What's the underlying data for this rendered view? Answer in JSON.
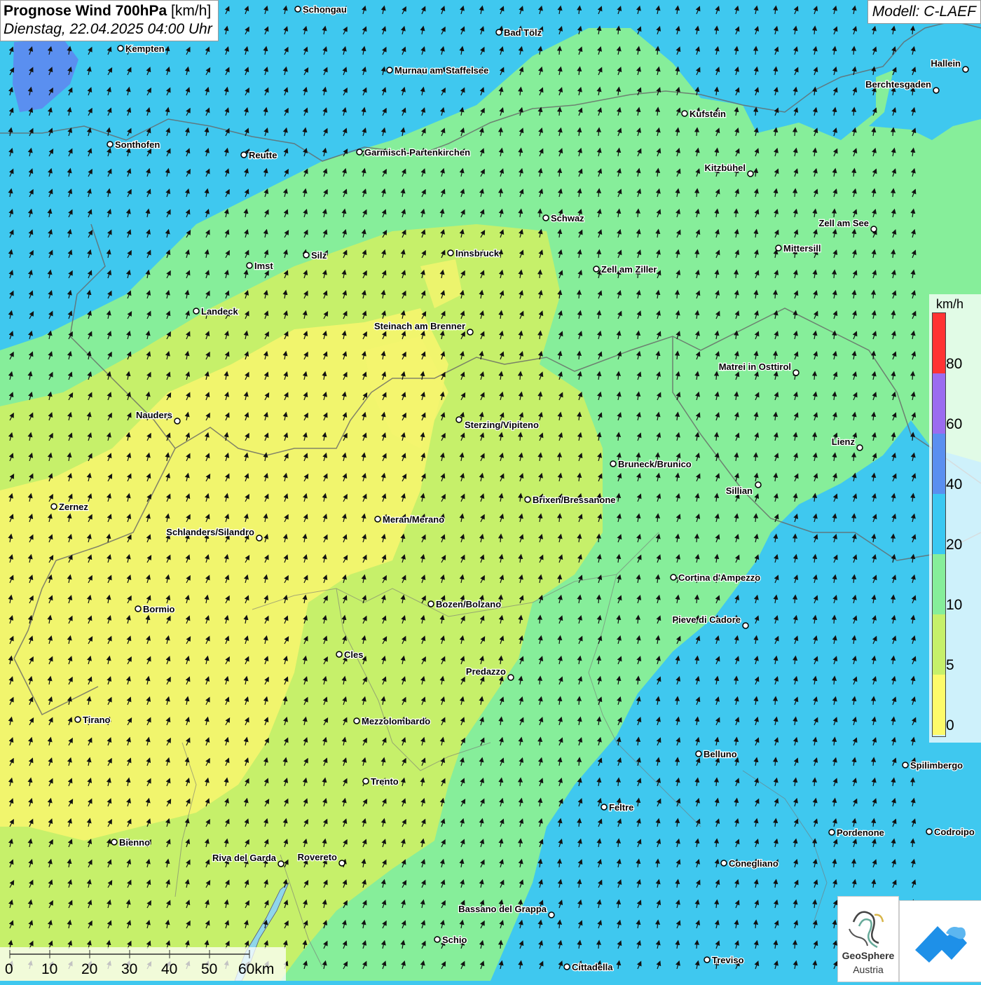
{
  "header": {
    "title_bold": "Prognose Wind 700hPa",
    "title_unit": " [km/h]",
    "datetime": "Dienstag, 22.04.2025 04:00 Uhr"
  },
  "model": "Modell: C-LAEF",
  "legend": {
    "unit": "km/h",
    "labels": [
      "80",
      "60",
      "40",
      "20",
      "10",
      "5",
      "0"
    ],
    "colors": [
      "#ff3333",
      "#9b6cf0",
      "#5a8ff0",
      "#39c8f2",
      "#86ee9a",
      "#c6f06a",
      "#fdfb6a"
    ]
  },
  "scale_bar": {
    "labels": [
      "0",
      "10",
      "20",
      "30",
      "40",
      "50",
      "60km"
    ]
  },
  "logos": {
    "geosphere_line1": "GeoSphere",
    "geosphere_line2": "Austria"
  },
  "cities": [
    {
      "name": "Schongau"
    },
    {
      "name": "Bad Tölz"
    },
    {
      "name": "Kempten"
    },
    {
      "name": "Murnau am Staffelsee"
    },
    {
      "name": "Hallein"
    },
    {
      "name": "Berchtesgaden"
    },
    {
      "name": "Kufstein"
    },
    {
      "name": "Sonthofen"
    },
    {
      "name": "Reutte"
    },
    {
      "name": "Garmisch-Partenkirchen"
    },
    {
      "name": "Kitzbühel"
    },
    {
      "name": "Schwaz"
    },
    {
      "name": "Zell am See"
    },
    {
      "name": "Mittersill"
    },
    {
      "name": "Innsbruck"
    },
    {
      "name": "Silz"
    },
    {
      "name": "Imst"
    },
    {
      "name": "Zell am Ziller"
    },
    {
      "name": "Landeck"
    },
    {
      "name": "Steinach am Brenner"
    },
    {
      "name": "Matrei in Osttirol"
    },
    {
      "name": "Nauders"
    },
    {
      "name": "Sterzing/Vipiteno"
    },
    {
      "name": "Lienz"
    },
    {
      "name": "Bruneck/Brunico"
    },
    {
      "name": "Sillian"
    },
    {
      "name": "Brixen/Bressanone"
    },
    {
      "name": "Zernez"
    },
    {
      "name": "Meran/Merano"
    },
    {
      "name": "Schlanders/Silandro"
    },
    {
      "name": "Cortina d'Ampezzo"
    },
    {
      "name": "Bozen/Bolzano"
    },
    {
      "name": "Bormio"
    },
    {
      "name": "Pieve di Cadore"
    },
    {
      "name": "Cles"
    },
    {
      "name": "Predazzo"
    },
    {
      "name": "Tirano"
    },
    {
      "name": "Mezzolombardo"
    },
    {
      "name": "Belluno"
    },
    {
      "name": "Spilimbergo"
    },
    {
      "name": "Trento"
    },
    {
      "name": "Feltre"
    },
    {
      "name": "Pordenone"
    },
    {
      "name": "Codroipo"
    },
    {
      "name": "Bienno"
    },
    {
      "name": "Riva del Garda"
    },
    {
      "name": "Rovereto"
    },
    {
      "name": "Conegliano"
    },
    {
      "name": "Bassano del Grappa"
    },
    {
      "name": "Schio"
    },
    {
      "name": "Treviso"
    },
    {
      "name": "Cittadella"
    }
  ]
}
